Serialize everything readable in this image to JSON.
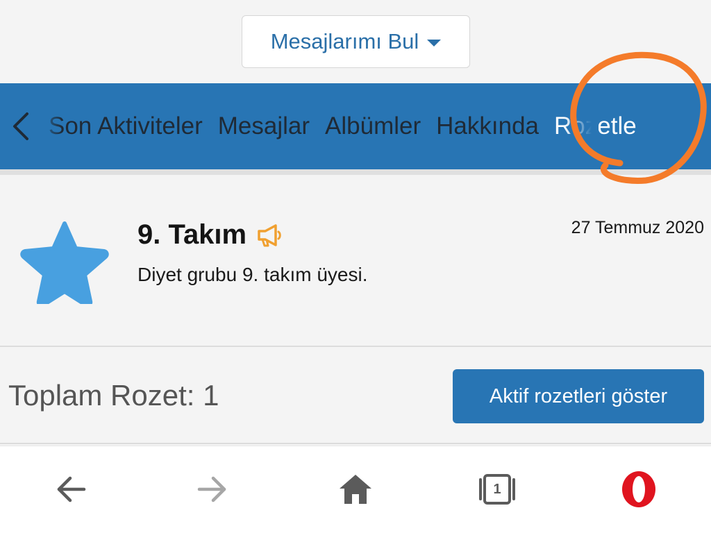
{
  "header": {
    "find_button_label": "Mesajlarımı Bul"
  },
  "tabs": {
    "items": [
      {
        "label": "Son Aktiviteler"
      },
      {
        "label": "Mesajlar"
      },
      {
        "label": "Albümler"
      },
      {
        "label": "Hakkında"
      },
      {
        "label": "Rozetle"
      }
    ],
    "active_index": 4
  },
  "badge": {
    "title": "9. Takım",
    "description": "Diyet grubu 9. takım üyesi.",
    "date": "27 Temmuz 2020",
    "icon": "star-icon",
    "tag_icon": "megaphone-icon"
  },
  "summary": {
    "total_label": "Toplam Rozet: 1",
    "show_active_button": "Aktif rozetleri göster"
  },
  "browser_nav": {
    "tab_count": "1"
  },
  "colors": {
    "accent": "#2875b4",
    "highlight": "#f47b2a",
    "star": "#48a0e0",
    "megaphone": "#f0a030"
  }
}
